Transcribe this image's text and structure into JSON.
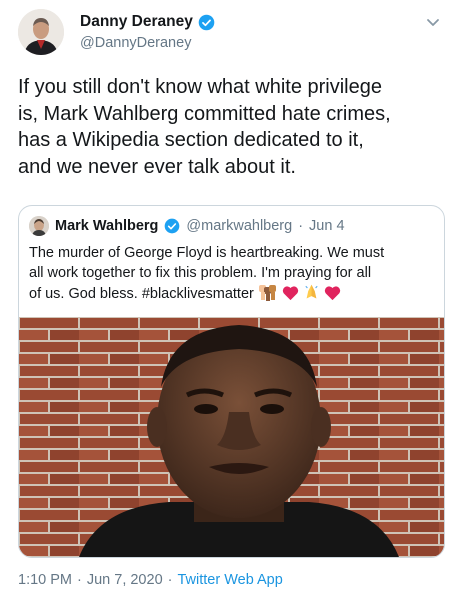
{
  "author": {
    "name": "Danny Deraney",
    "handle": "@DannyDeraney"
  },
  "tweet": {
    "text_lines": [
      "If you still don't know what white privilege",
      "is, Mark Wahlberg committed hate crimes,",
      "has a Wikipedia section dedicated to it,",
      "and we never ever talk about it."
    ]
  },
  "quoted_tweet": {
    "name": "Mark Wahlberg",
    "handle": "@markwahlberg",
    "separator": "·",
    "date": "Jun 4",
    "text_lines": [
      "The murder of George Floyd is heartbreaking. We must",
      "all work together to fix this problem. I'm praying for all",
      "of us. God bless. #blacklivesmatter"
    ],
    "emojis": [
      "raised-fists-emoji",
      "red-heart-emoji",
      "praying-hands-emoji",
      "red-heart-emoji"
    ]
  },
  "footer": {
    "time": "1:10 PM",
    "sep1": "·",
    "date": "Jun 7, 2020",
    "sep2": "·",
    "app": "Twitter Web App"
  },
  "colors": {
    "verified": "#1da1f2",
    "secondary_text": "#657786",
    "link": "#1b95e0",
    "border": "#ccd6dd",
    "heart": "#e0245e",
    "brick": "#9a4a33"
  }
}
